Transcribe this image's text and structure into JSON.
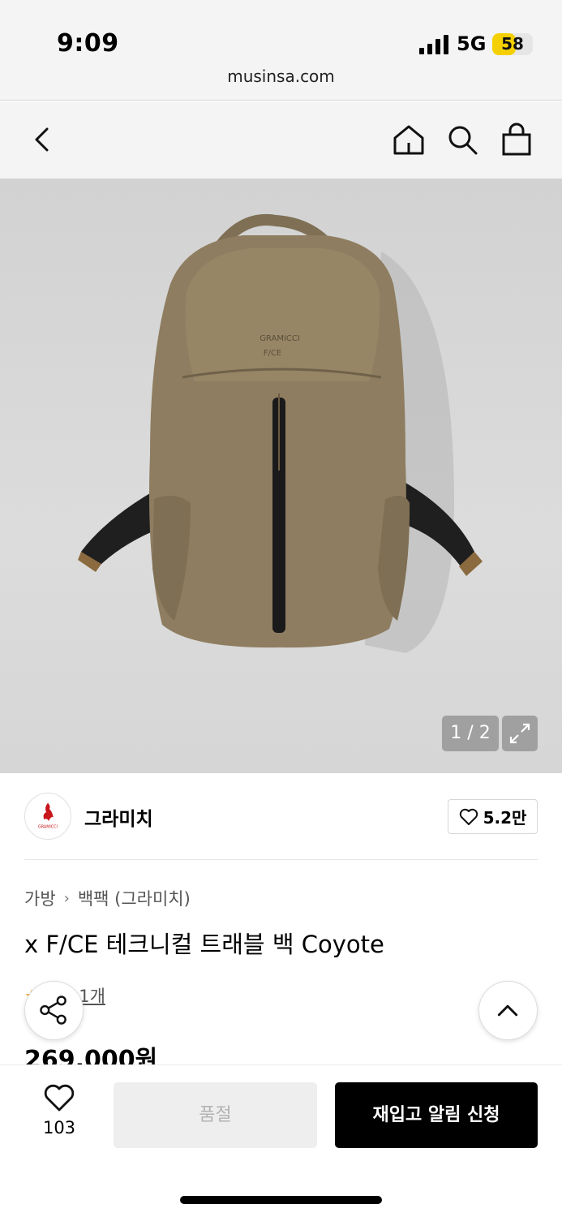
{
  "status_bar": {
    "time": "9:09",
    "network": "5G",
    "battery_percent": "58",
    "battery_level": 0.58,
    "url": "musinsa.com"
  },
  "nav": {
    "icons": [
      "back-arrow-icon",
      "home-icon",
      "search-icon",
      "shopping-bag-icon"
    ]
  },
  "gallery": {
    "pager": "1 / 2",
    "icons": [
      "expand-icon"
    ]
  },
  "brand": {
    "name": "그라미치",
    "likes": "5.2만",
    "logo_text": "GRAMICCI"
  },
  "product": {
    "breadcrumb": [
      "가방",
      "백팩 (그라미치)"
    ],
    "title": "x F/CE 테크니컬 트래블 백 Coyote",
    "reviews": "후기 1개",
    "price": "269,000원"
  },
  "actions": {
    "wish_count": "103",
    "soldout_label": "품절",
    "restock_label": "재입고 알림 신청"
  },
  "colors": {
    "accent": "#000000",
    "battery": "#f5d000",
    "star": "#f5a623",
    "bag": "#8e7d60"
  }
}
